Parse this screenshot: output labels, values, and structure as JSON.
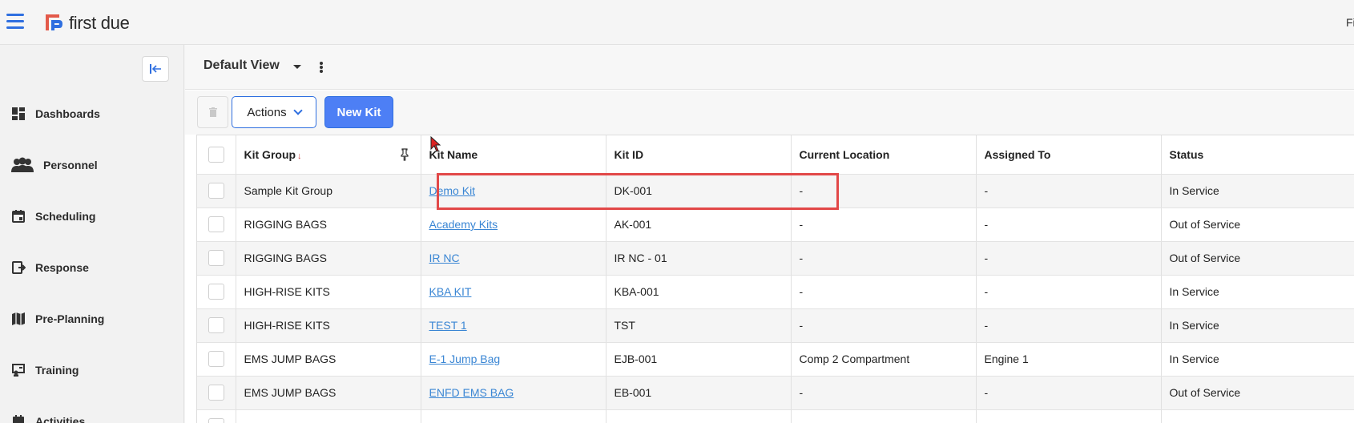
{
  "app": {
    "logo_text": "first due",
    "top_right_text": "Fi",
    "brand_color": "#2f6fe0",
    "logo_color": "#e35a4a"
  },
  "sidebar": {
    "collapse_icon": "collapse-left-icon",
    "items": [
      {
        "label": "Dashboards",
        "icon": "dashboard-icon"
      },
      {
        "label": "Personnel",
        "icon": "people-icon"
      },
      {
        "label": "Scheduling",
        "icon": "calendar-icon"
      },
      {
        "label": "Response",
        "icon": "response-icon"
      },
      {
        "label": "Pre-Planning",
        "icon": "map-icon"
      },
      {
        "label": "Training",
        "icon": "training-icon"
      },
      {
        "label": "Activities",
        "icon": "activities-icon"
      }
    ]
  },
  "view": {
    "title": "Default View"
  },
  "toolbar": {
    "actions_label": "Actions",
    "new_kit_label": "New Kit"
  },
  "table": {
    "columns": [
      "Kit Group",
      "Kit Name",
      "Kit ID",
      "Current Location",
      "Assigned To",
      "Status"
    ],
    "sort_indicator": "↓",
    "rows": [
      {
        "group": "Sample Kit Group",
        "name": "Demo Kit",
        "id": "DK-001",
        "location": "-",
        "assigned": "-",
        "status": "In Service"
      },
      {
        "group": "RIGGING BAGS",
        "name": "Academy Kits",
        "id": "AK-001",
        "location": "-",
        "assigned": "-",
        "status": "Out of Service"
      },
      {
        "group": "RIGGING BAGS",
        "name": "IR NC",
        "id": "IR NC - 01",
        "location": "-",
        "assigned": "-",
        "status": "Out of Service"
      },
      {
        "group": "HIGH-RISE KITS",
        "name": "KBA KIT",
        "id": "KBA-001",
        "location": "-",
        "assigned": "-",
        "status": "In Service"
      },
      {
        "group": "HIGH-RISE KITS",
        "name": "TEST 1",
        "id": "TST",
        "location": "-",
        "assigned": "-",
        "status": "In Service"
      },
      {
        "group": "EMS JUMP BAGS",
        "name": "E-1 Jump Bag",
        "id": "EJB-001",
        "location": "Comp 2 Compartment",
        "assigned": "Engine 1",
        "status": "In Service"
      },
      {
        "group": "EMS JUMP BAGS",
        "name": "ENFD EMS BAG",
        "id": "EB-001",
        "location": "-",
        "assigned": "-",
        "status": "Out of Service"
      },
      {
        "group": "",
        "name": "",
        "id": "",
        "location": "",
        "assigned": "",
        "status": ""
      }
    ]
  }
}
